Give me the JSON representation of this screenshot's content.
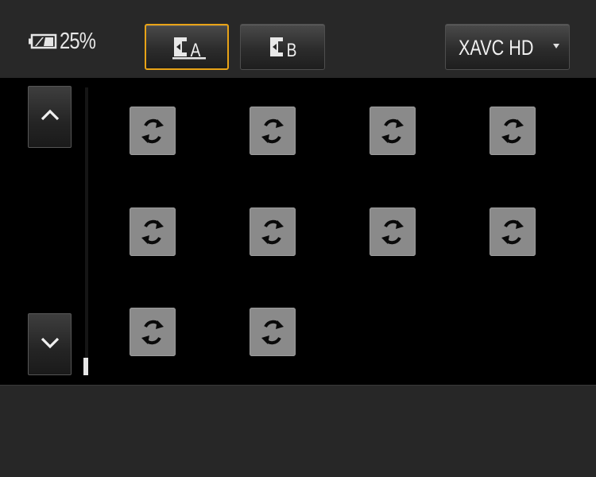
{
  "status": {
    "battery_icon": "battery-icon",
    "battery_percent": "25%"
  },
  "media_slots": [
    {
      "id": "A",
      "label": "A",
      "icon": "memory-card-slot-icon",
      "selected": true
    },
    {
      "id": "B",
      "label": "B",
      "icon": "memory-card-slot-icon",
      "selected": false
    }
  ],
  "format": {
    "value": "XAVC HD",
    "icon": "dropdown-caret-icon"
  },
  "navigation": {
    "up_icon": "chevron-up-icon",
    "down_icon": "chevron-down-icon"
  },
  "thumbnails": {
    "icon": "loading-refresh-icon",
    "count": 10
  },
  "colors": {
    "accent_selected": "#e8a317",
    "background": "#000000",
    "panel": "#282828",
    "thumbnail": "#8a8a8a"
  }
}
